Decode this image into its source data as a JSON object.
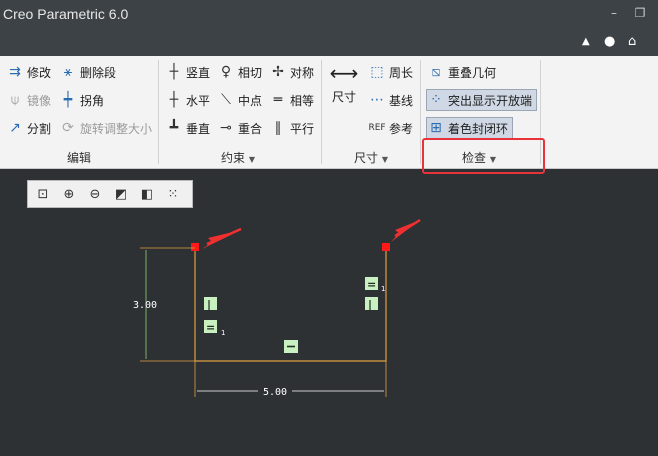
{
  "window": {
    "title": "Creo Parametric 6.0",
    "minimize_glyph": "–",
    "restore_glyph": "❐"
  },
  "tab_icons": {
    "collapse": "▲",
    "search": "●",
    "help": "⌂"
  },
  "ribbon": {
    "edit": {
      "label": "编辑",
      "modify": "修改",
      "delete_segment": "删除段",
      "mirror": "镜像",
      "corner": "拐角",
      "divide": "分割",
      "rotate_resize": "旋转调整大小"
    },
    "constrain": {
      "label": "约束",
      "vertical": "竖直",
      "tangent": "相切",
      "symmetric": "对称",
      "horizontal": "水平",
      "midpoint": "中点",
      "equal": "相等",
      "perpendicular": "垂直",
      "coincident": "重合",
      "parallel": "平行"
    },
    "dimension": {
      "label": "尺寸",
      "dimension": "尺寸",
      "perimeter": "周长",
      "baseline": "基线",
      "reference": "参考"
    },
    "inspect": {
      "label": "检查",
      "overlapping_geometry": "重叠几何",
      "highlight_open_ends": "突出显示开放端",
      "shade_closed_loops": "着色封闭环"
    }
  },
  "sketch": {
    "dim_height": "3.00",
    "dim_width": "5.00",
    "constraint_equal": "=",
    "constraint_vertical": "|",
    "constraint_horizontal": "—",
    "subscript": "1"
  }
}
